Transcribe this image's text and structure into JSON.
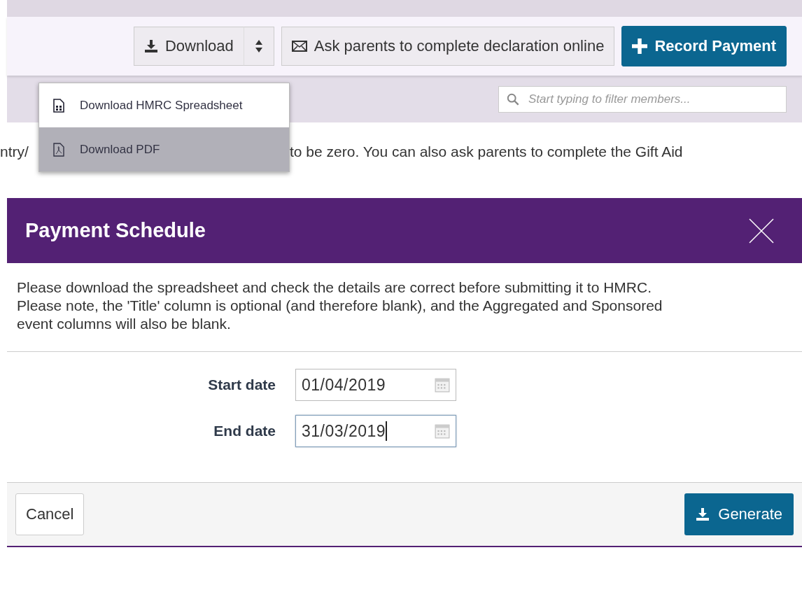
{
  "toolbar": {
    "download_button": "Download",
    "ask_button": "Ask parents to complete declaration online",
    "record_button": "Record Payment"
  },
  "download_menu": {
    "items": [
      {
        "label": "Download HMRC Spreadsheet",
        "kind": "spreadsheet",
        "selected": false
      },
      {
        "label": "Download PDF",
        "kind": "pdf",
        "selected": true
      }
    ]
  },
  "filter": {
    "placeholder": "Start typing to filter members..."
  },
  "background_text": {
    "before_menu": "ntry/",
    "after_menu": "to be zero. You can also ask parents to complete the Gift Aid"
  },
  "dialog": {
    "title": "Payment Schedule",
    "message": "Please download the spreadsheet and check the details are correct before submitting it to HMRC. Please note, the 'Title' column is optional (and therefore blank), and the Aggregated and Sponsored event columns will also be blank.",
    "fields": [
      {
        "label": "Start date",
        "value": "01/04/2019",
        "focused": false
      },
      {
        "label": "End date",
        "value": "31/03/2019",
        "focused": true
      }
    ],
    "buttons": {
      "cancel": "Cancel",
      "generate": "Generate"
    }
  }
}
